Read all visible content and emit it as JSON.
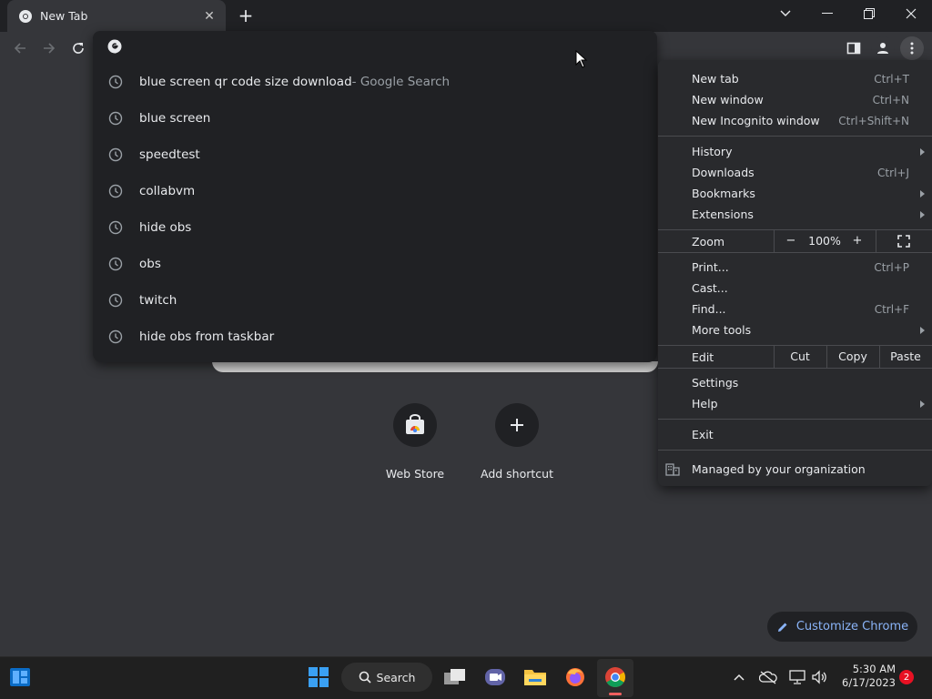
{
  "tab": {
    "title": "New Tab"
  },
  "window_controls": {
    "minimize": "minimize",
    "restore": "restore",
    "close": "close"
  },
  "omnibox": {
    "value": "",
    "suggestions": [
      {
        "text": "blue screen qr code size download",
        "suffix": " - Google Search"
      },
      {
        "text": "blue screen",
        "suffix": ""
      },
      {
        "text": "speedtest",
        "suffix": ""
      },
      {
        "text": "collabvm",
        "suffix": ""
      },
      {
        "text": "hide obs",
        "suffix": ""
      },
      {
        "text": "obs",
        "suffix": ""
      },
      {
        "text": "twitch",
        "suffix": ""
      },
      {
        "text": "hide obs from taskbar",
        "suffix": ""
      }
    ]
  },
  "shortcuts": [
    {
      "label": "Web Store",
      "icon": "web-store-icon"
    },
    {
      "label": "Add shortcut",
      "icon": "plus-icon"
    }
  ],
  "customize": {
    "label": "Customize Chrome"
  },
  "menu": {
    "new_tab": {
      "label": "New tab",
      "shortcut": "Ctrl+T"
    },
    "new_window": {
      "label": "New window",
      "shortcut": "Ctrl+N"
    },
    "new_incognito": {
      "label": "New Incognito window",
      "shortcut": "Ctrl+Shift+N"
    },
    "history": {
      "label": "History"
    },
    "downloads": {
      "label": "Downloads",
      "shortcut": "Ctrl+J"
    },
    "bookmarks": {
      "label": "Bookmarks"
    },
    "extensions": {
      "label": "Extensions"
    },
    "zoom": {
      "label": "Zoom",
      "minus": "−",
      "value": "100%",
      "plus": "+"
    },
    "print": {
      "label": "Print...",
      "shortcut": "Ctrl+P"
    },
    "cast": {
      "label": "Cast..."
    },
    "find": {
      "label": "Find...",
      "shortcut": "Ctrl+F"
    },
    "more_tools": {
      "label": "More tools"
    },
    "edit": {
      "label": "Edit",
      "cut": "Cut",
      "copy": "Copy",
      "paste": "Paste"
    },
    "settings": {
      "label": "Settings"
    },
    "help": {
      "label": "Help"
    },
    "exit": {
      "label": "Exit"
    },
    "managed": {
      "label": "Managed by your organization"
    }
  },
  "taskbar": {
    "search_label": "Search",
    "time": "5:30 AM",
    "date": "6/17/2023",
    "notification_count": "2"
  },
  "colors": {
    "accent": "#8ab4f8",
    "background": "#35363a",
    "menu_bg": "#292a2d",
    "badge": "#e81123"
  }
}
